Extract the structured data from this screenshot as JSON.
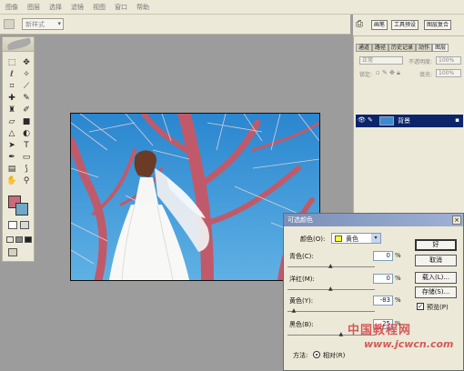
{
  "menu": [
    "图像",
    "图层",
    "选择",
    "滤镜",
    "视图",
    "窗口",
    "帮助"
  ],
  "options_bar": {
    "style_select": "新样式"
  },
  "palette_buttons": [
    "画笔",
    "工具预设",
    "图层复合"
  ],
  "layers_panel": {
    "tabs": [
      "通道",
      "路径",
      "历史记录",
      "动作",
      "图层"
    ],
    "active_tab": "图层",
    "blend_mode": "正常",
    "opacity_label": "不透明度:",
    "opacity_value": "100%",
    "lock_label": "锁定:",
    "fill_label": "填充:",
    "fill_value": "100%",
    "layer_name": "背景"
  },
  "dialog": {
    "title": "可选颜色",
    "color_label": "颜色(O):",
    "color_value": "黄色",
    "cyan_label": "青色(C):",
    "cyan_value": "0",
    "magenta_label": "洋红(M):",
    "magenta_value": "0",
    "yellow_label": "黄色(Y):",
    "yellow_value": "-83",
    "black_label": "黑色(B):",
    "black_value": "25",
    "percent": "%",
    "ok": "好",
    "cancel": "取消",
    "load": "载入(L)...",
    "save": "存储(S)...",
    "preview": "预览(P)",
    "method_label": "方法:",
    "method_relative": "相对(R)",
    "slider_positions": {
      "cyan": 0.5,
      "magenta": 0.5,
      "yellow": 0.08,
      "black": 0.62
    }
  },
  "colors": {
    "foreground": "#c96b7a",
    "background": "#6fa9c7",
    "sky": "#2f8fd4",
    "tree": "#c05a6a"
  },
  "watermark": {
    "cn": "中国教程网",
    "url": "www.jcwcn.com"
  }
}
